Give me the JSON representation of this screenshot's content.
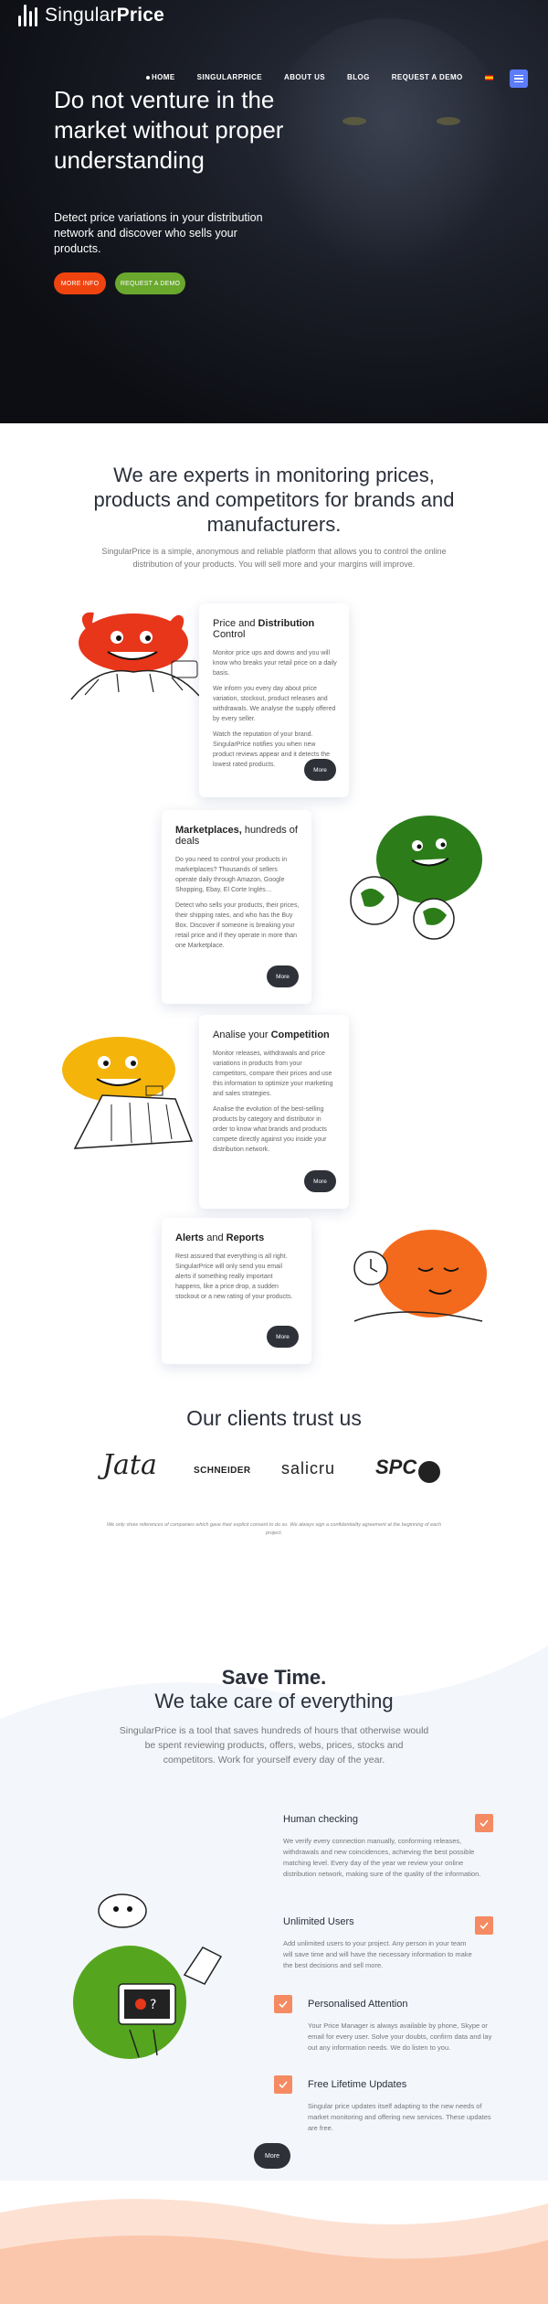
{
  "header": {
    "logo_light": "Singular",
    "logo_bold": "Price",
    "nav": [
      "HOME",
      "SINGULARPRICE",
      "ABOUT US",
      "BLOG",
      "REQUEST A DEMO"
    ]
  },
  "hero": {
    "title": "Do not venture in the market without proper understanding",
    "subtitle": "Detect price variations in your distribution network and discover who sells your products.",
    "btn_info": "MORE INFO",
    "btn_demo": "REQUEST A DEMO"
  },
  "experts": {
    "title": "We are experts in monitoring prices, products and competitors for brands and manufacturers.",
    "subtitle": "SingularPrice is a simple, anonymous and reliable platform that allows you to control the online distribution of your products. You will sell more and your margins will improve."
  },
  "cards": [
    {
      "title_pre": "Price and ",
      "title_bold": "Distribution",
      "title_post": " Control",
      "p1": "Monitor price ups and downs and you will know who breaks your retail price on a daily basis.",
      "p2": "We inform you every day about price variation, stockout, product releases and withdrawals. We analyse the supply offered by every seller.",
      "p3": "Watch the reputation of your brand. SingularPrice notifies you when new product reviews appear and it detects the lowest rated products.",
      "more": "More"
    },
    {
      "title_pre": "",
      "title_bold": "Marketplaces,",
      "title_post": " hundreds of deals",
      "p1": "Do you need to control your products in marketplaces? Thousands of sellers operate daily through Amazon, Google Shopping, Ebay, El Corte Inglés…",
      "p2": "Detect who sells your products, their prices, their shipping rates, and who has the Buy Box. Discover if someone is breaking your retail price and if they operate in more than one Marketplace.",
      "p3": "",
      "more": "More"
    },
    {
      "title_pre": "Analise your ",
      "title_bold": "Competition",
      "title_post": "",
      "p1": "Monitor releases, withdrawals and price variations in products from your competitors, compare their prices and use this information to optimize your marketing and sales strategies.",
      "p2": "Analise the evolution of the best-selling products by category and distributor in order to know what brands and products compete directly against you inside your distribution network.",
      "p3": "",
      "more": "More"
    },
    {
      "title_pre": "",
      "title_bold": "Alerts",
      "title_post": " and ",
      "title_bold2": "Reports",
      "p1": "Rest assured that everything is all right. SingularPrice will only send you email alerts if something really important happens, like a price drop, a sudden stockout or a new rating of your products.",
      "p2": "",
      "p3": "",
      "more": "More"
    }
  ],
  "clients": {
    "title": "Our clients trust us",
    "logos": [
      "Jata",
      "SCHNEIDER",
      "salicru",
      "SPC"
    ],
    "disclaimer": "We only show references of companies which gave their explicit consent to do so. We always sign a confidentiality agreement at the beginning of each project."
  },
  "save": {
    "title_bold": "Save Time.",
    "title": "We take care of everything",
    "subtitle": "SingularPrice is a tool that saves hundreds of hours that otherwise would be spent reviewing products, offers, webs, prices, stocks and competitors. Work for yourself every day of the year.",
    "features": [
      {
        "title": "Human checking",
        "text": "We verify every connection manually, conforming releases, withdrawals and new coincidences, achieving the best possible matching level. Every day of the year we review your online distribution network, making sure of the quality of the information."
      },
      {
        "title": "Unlimited Users",
        "text": "Add unlimited users to your project. Any person in your team will save time and will have the necessary information to make the best decisions and sell more."
      },
      {
        "title": "Personalised Attention",
        "text": "Your Price Manager is always available by phone, Skype or email for every user. Solve your doubts, confirm data and lay out any information needs. We do listen to you."
      },
      {
        "title": "Free Lifetime Updates",
        "text": "Singular price updates itself adapting to the new needs of market monitoring and offering new services. These updates are free."
      }
    ],
    "more": "More"
  },
  "colors": {
    "accent_red": "#f04410",
    "accent_green": "#6aa82e",
    "check_orange": "#f58b63",
    "menu_blue": "#5c7cfa",
    "dark_button": "#2f3138"
  }
}
